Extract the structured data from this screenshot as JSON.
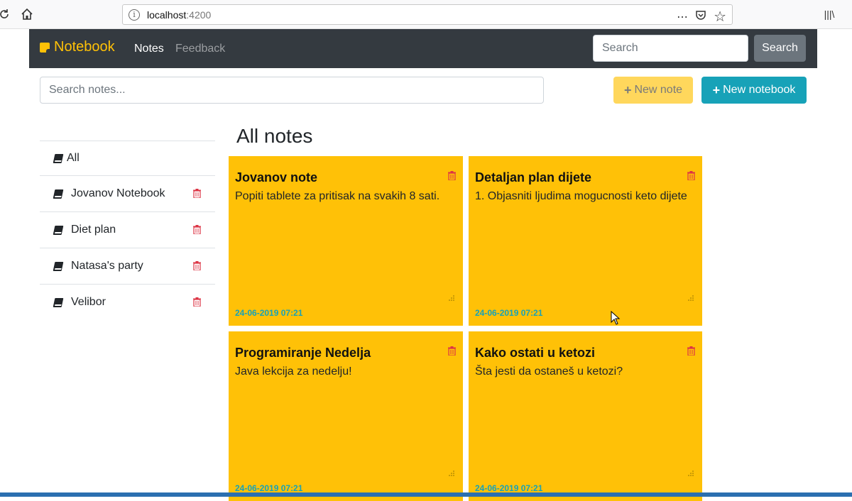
{
  "browser": {
    "url_host": "localhost",
    "url_port": ":4200",
    "actions": {
      "more_icon": "⋯",
      "pocket_icon": "pocket-icon",
      "star_icon": "☆",
      "library_icon": "|||\\"
    }
  },
  "navbar": {
    "brand": "Notebook",
    "links": [
      "Notes",
      "Feedback"
    ],
    "search_placeholder": "Search",
    "search_button": "Search"
  },
  "toolbar": {
    "search_placeholder": "Search notes...",
    "new_note": "New note",
    "new_notebook": "New notebook"
  },
  "sidebar": {
    "items": [
      {
        "label": "All"
      },
      {
        "label": "Jovanov Notebook"
      },
      {
        "label": "Diet plan"
      },
      {
        "label": "Natasa's party"
      },
      {
        "label": "Velibor"
      }
    ]
  },
  "main": {
    "title": "All notes",
    "notes": [
      {
        "title": "Jovanov note",
        "body": "Popiti tablete za pritisak na svakih 8 sati.",
        "date": "24-06-2019 07:21"
      },
      {
        "title": "Detaljan plan dijete",
        "body": "1. Objasniti ljudima mogucnosti keto dijete",
        "date": "24-06-2019 07:21"
      },
      {
        "title": "Programiranje Nedelja",
        "body": "Java lekcija za nedelju!",
        "date": "24-06-2019 07:21"
      },
      {
        "title": "Kako ostati u ketozi",
        "body": "Šta jesti da ostaneš u ketozi?",
        "date": "24-06-2019 07:21"
      }
    ]
  },
  "colors": {
    "navbar": "#343a40",
    "brand": "#ffc107",
    "note_card": "#ffc107",
    "date": "#17a2b8",
    "trash": "#dc3545",
    "new_notebook": "#17a2b8",
    "new_note": "#ffd75c"
  }
}
